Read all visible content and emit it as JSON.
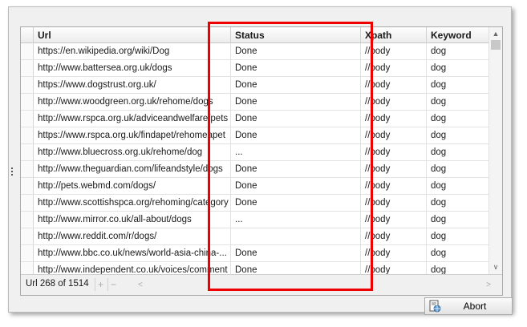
{
  "grid": {
    "columns": [
      "Url",
      "Status",
      "Xpath",
      "Keyword"
    ],
    "rows": [
      [
        "https://en.wikipedia.org/wiki/Dog",
        "Done",
        "//body",
        "dog"
      ],
      [
        "http://www.battersea.org.uk/dogs",
        "Done",
        "//body",
        "dog"
      ],
      [
        "https://www.dogstrust.org.uk/",
        "Done",
        "//body",
        "dog"
      ],
      [
        "http://www.woodgreen.org.uk/rehome/dogs",
        "Done",
        "//body",
        "dog"
      ],
      [
        "http://www.rspca.org.uk/adviceandwelfare/pets",
        "Done",
        "//body",
        "dog"
      ],
      [
        "https://www.rspca.org.uk/findapet/rehomeapet",
        "Done",
        "//body",
        "dog"
      ],
      [
        "http://www.bluecross.org.uk/rehome/dog",
        "...",
        "//body",
        "dog"
      ],
      [
        "http://www.theguardian.com/lifeandstyle/dogs",
        "Done",
        "//body",
        "dog"
      ],
      [
        "http://pets.webmd.com/dogs/",
        "Done",
        "//body",
        "dog"
      ],
      [
        "http://www.scottishspca.org/rehoming/category",
        "Done",
        "//body",
        "dog"
      ],
      [
        "http://www.mirror.co.uk/all-about/dogs",
        "...",
        "//body",
        "dog"
      ],
      [
        "http://www.reddit.com/r/dogs/",
        "",
        "//body",
        "dog"
      ],
      [
        "http://www.bbc.co.uk/news/world-asia-china-...",
        "Done",
        "//body",
        "dog"
      ],
      [
        "http://www.independent.co.uk/voices/comment",
        "Done",
        "//body",
        "dog"
      ]
    ]
  },
  "footer": {
    "record_text": "Url 268 of 1514",
    "add_symbol": "+",
    "remove_symbol": "−",
    "scroll_left": "<",
    "scroll_right": ">"
  },
  "scrollbar": {
    "up": "▲",
    "down": "∨"
  },
  "abort_button": {
    "label": "Abort"
  },
  "colors": {
    "highlight": "#ee0000",
    "grid_border": "#a9a9a9"
  }
}
